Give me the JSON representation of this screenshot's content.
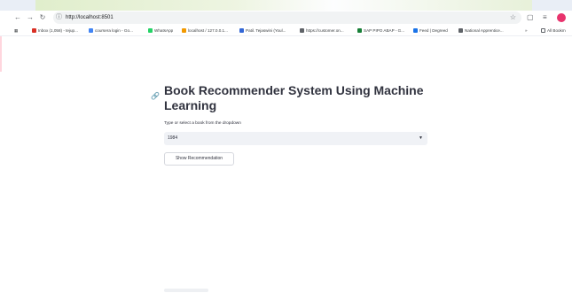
{
  "browser": {
    "url": "http://localhost:8501",
    "bookmarks": [
      {
        "label": "Inbox (1,058) - tejup...",
        "color": "#d93025"
      },
      {
        "label": "coursera login - Go...",
        "color": "#4285f4"
      },
      {
        "label": "WhatsApp",
        "color": "#25d366"
      },
      {
        "label": "localhost / 127.0.0.1...",
        "color": "#f29900"
      },
      {
        "label": "Patil. Tejaswini (Youl...",
        "color": "#3367d6"
      },
      {
        "label": "https://customer.on...",
        "color": "#5f6368"
      },
      {
        "label": "SAP PIPO ABAP - G...",
        "color": "#188038"
      },
      {
        "label": "Feed | Degreed",
        "color": "#1a73e8"
      },
      {
        "label": "National Apprentice...",
        "color": "#5f6368"
      }
    ],
    "all_bookmarks": "All Bookm",
    "icons": {
      "back": "back-arrow-icon",
      "forward": "forward-arrow-icon",
      "reload": "reload-icon",
      "info": "site-info-icon",
      "star": "star-icon",
      "extension": "extension-icon",
      "menu": "media-icon"
    }
  },
  "app": {
    "title": "Book Recommender System Using Machine Learning",
    "select_label": "Type or select a book from the dropdown",
    "selected_book": "1984",
    "button_label": "Show Recommendation"
  }
}
